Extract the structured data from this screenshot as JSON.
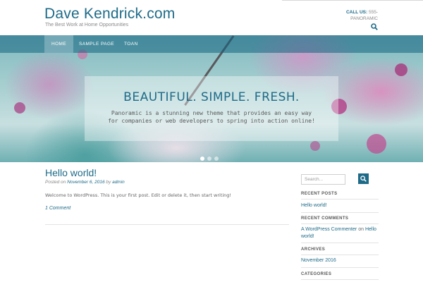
{
  "header": {
    "site_title": "Dave Kendrick.com",
    "tagline": "The Best Work at Home Opportunities",
    "call_label": "CALL US:",
    "call_number": "555-",
    "call_brand": "PANORAMIC"
  },
  "nav": {
    "items": [
      {
        "label": "HOME"
      },
      {
        "label": "SAMPLE PAGE"
      },
      {
        "label": "TOAN"
      }
    ]
  },
  "hero": {
    "title": "BEAUTIFUL. SIMPLE. FRESH.",
    "text": "Panoramic is a stunning new theme that provides an easy way for companies or web developers to spring into action online!",
    "slides_total": 3,
    "slide_active": 1
  },
  "post": {
    "title": "Hello world!",
    "posted_on": "Posted on",
    "date": "November 6, 2016",
    "by": "by",
    "author": "admin",
    "body": "Welcome to WordPress. This is your first post. Edit or delete it, then start writing!",
    "comments": "1 Comment"
  },
  "sidebar": {
    "search_placeholder": "Search...",
    "recent_posts_title": "RECENT POSTS",
    "recent_post": "Hello world!",
    "recent_comments_title": "RECENT COMMENTS",
    "comment_author": "A WordPress Commenter",
    "comment_on": "on",
    "comment_post": "Hello world!",
    "archives_title": "ARCHIVES",
    "archive_item": "November 2016",
    "categories_title": "CATEGORIES"
  },
  "colors": {
    "accent": "#1e6b88",
    "text": "#555555"
  }
}
